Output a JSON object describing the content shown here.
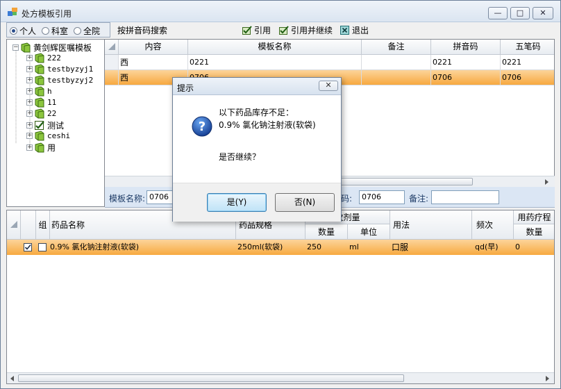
{
  "window": {
    "title": "处方模板引用",
    "min_label": "—",
    "max_label": "□",
    "close_label": "✕"
  },
  "toolbar": {
    "scope_options": [
      {
        "label": "个人",
        "selected": true
      },
      {
        "label": "科室",
        "selected": false
      },
      {
        "label": "全院",
        "selected": false
      }
    ],
    "pinyin_search_label": "按拼音码搜索",
    "cite_label": "引用",
    "cite_continue_label": "引用并继续",
    "exit_label": "退出"
  },
  "tree": {
    "root": "黄剑辉医嘱模板",
    "items": [
      "222",
      "testbyzyj1",
      "testbyzyj2",
      "h",
      "11",
      "22",
      "测试",
      "ceshi",
      "用"
    ]
  },
  "template_grid": {
    "columns": [
      "内容",
      "模板名称",
      "备注",
      "拼音码",
      "五笔码"
    ],
    "rows": [
      {
        "content": "西",
        "name": "0221",
        "note": "",
        "pinyin": "0221",
        "wubi": "0221"
      },
      {
        "content": "西",
        "name": "0706",
        "note": "",
        "pinyin": "0706",
        "wubi": "0706"
      }
    ]
  },
  "form": {
    "name_label": "模板名称:",
    "name_value": "0706",
    "code_label": "拼音码:",
    "code_value": "0706",
    "note_label": "备注:",
    "note_value": ""
  },
  "drug_grid": {
    "group_label": "组",
    "drug_name_label": "药品名称",
    "spec_label": "药品规格",
    "dose_label": "次剂量",
    "dose_qty_label": "数量",
    "dose_unit_label": "单位",
    "usage_label": "用法",
    "freq_label": "频次",
    "course_label": "用药疗程",
    "course_qty_label": "数量",
    "rows": [
      {
        "checked": true,
        "group": false,
        "name": "0.9% 氯化钠注射液(软袋)",
        "spec": "250ml(软袋)",
        "qty": "250",
        "unit": "ml",
        "usage": "口服",
        "freq": "qd(早)",
        "course": "0"
      }
    ]
  },
  "dialog": {
    "title": "提示",
    "close_label": "✕",
    "message_line1": "以下药品库存不足：",
    "message_line2": "0.9% 氯化钠注射液(软袋)",
    "question": "是否继续？",
    "yes_label": "是(Y)",
    "no_label": "否(N)"
  },
  "colors": {
    "selection": "#f7a940",
    "accent": "#1d3b66"
  }
}
